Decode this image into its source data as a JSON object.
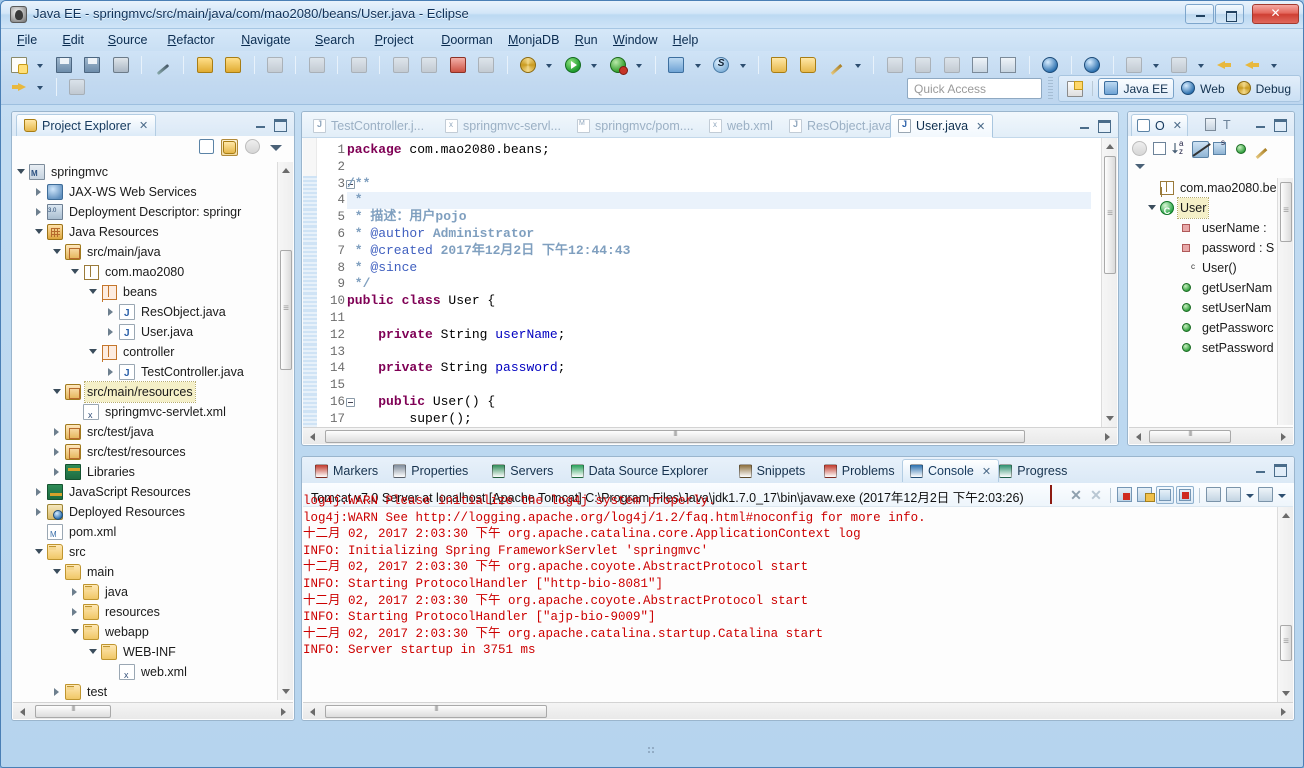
{
  "window": {
    "title": "Java EE - springmvc/src/main/java/com/mao2080/beans/User.java - Eclipse",
    "minimize_label": "",
    "maximize_label": "",
    "close_label": "✕"
  },
  "menubar": [
    {
      "label": "File"
    },
    {
      "label": "Edit"
    },
    {
      "label": "Source"
    },
    {
      "label": "Refactor"
    },
    {
      "label": "Navigate"
    },
    {
      "label": "Search"
    },
    {
      "label": "Project"
    },
    {
      "label": "Doorman"
    },
    {
      "label": "MonjaDB"
    },
    {
      "label": "Run"
    },
    {
      "label": "Window"
    },
    {
      "label": "Help"
    }
  ],
  "toolbar": {
    "quick_access_placeholder": "Quick Access",
    "perspectives": [
      {
        "label": "Java EE",
        "active": true
      },
      {
        "label": "Web",
        "active": false
      },
      {
        "label": "Debug",
        "active": false
      }
    ]
  },
  "project_explorer": {
    "title": "Project Explorer",
    "close": "✕",
    "tree": [
      {
        "label": "springmvc",
        "indent": 0,
        "twist": "open",
        "icon": "ic-proj"
      },
      {
        "label": "JAX-WS Web Services",
        "indent": 1,
        "twist": "closed",
        "icon": "ic-ws"
      },
      {
        "label": "Deployment Descriptor: springr",
        "indent": 1,
        "twist": "closed",
        "icon": "ic-dd"
      },
      {
        "label": "Java Resources",
        "indent": 1,
        "twist": "open",
        "icon": "ic-jres"
      },
      {
        "label": "src/main/java",
        "indent": 2,
        "twist": "open",
        "icon": "ic-pkgf"
      },
      {
        "label": "com.mao2080",
        "indent": 3,
        "twist": "open",
        "icon": "ic-pkg"
      },
      {
        "label": "beans",
        "indent": 4,
        "twist": "open",
        "icon": "ic-pkgo"
      },
      {
        "label": "ResObject.java",
        "indent": 5,
        "twist": "closed",
        "icon": "ic-java"
      },
      {
        "label": "User.java",
        "indent": 5,
        "twist": "closed",
        "icon": "ic-java"
      },
      {
        "label": "controller",
        "indent": 4,
        "twist": "open",
        "icon": "ic-pkgo"
      },
      {
        "label": "TestController.java",
        "indent": 5,
        "twist": "closed",
        "icon": "ic-java"
      },
      {
        "label": "src/main/resources",
        "indent": 2,
        "twist": "open",
        "icon": "ic-pkgf",
        "selected": true
      },
      {
        "label": "springmvc-servlet.xml",
        "indent": 3,
        "twist": "none",
        "icon": "ic-xml"
      },
      {
        "label": "src/test/java",
        "indent": 2,
        "twist": "closed",
        "icon": "ic-pkgf"
      },
      {
        "label": "src/test/resources",
        "indent": 2,
        "twist": "closed",
        "icon": "ic-pkgf"
      },
      {
        "label": "Libraries",
        "indent": 2,
        "twist": "closed",
        "icon": "ic-lib"
      },
      {
        "label": "JavaScript Resources",
        "indent": 1,
        "twist": "closed",
        "icon": "ic-jsres"
      },
      {
        "label": "Deployed Resources",
        "indent": 1,
        "twist": "closed",
        "icon": "ic-depl"
      },
      {
        "label": "pom.xml",
        "indent": 1,
        "twist": "none",
        "icon": "ic-m"
      },
      {
        "label": "src",
        "indent": 1,
        "twist": "open",
        "icon": "ic-folder"
      },
      {
        "label": "main",
        "indent": 2,
        "twist": "open",
        "icon": "ic-folder"
      },
      {
        "label": "java",
        "indent": 3,
        "twist": "closed",
        "icon": "ic-folder"
      },
      {
        "label": "resources",
        "indent": 3,
        "twist": "closed",
        "icon": "ic-folder"
      },
      {
        "label": "webapp",
        "indent": 3,
        "twist": "open",
        "icon": "ic-folder"
      },
      {
        "label": "WEB-INF",
        "indent": 4,
        "twist": "open",
        "icon": "ic-folder"
      },
      {
        "label": "web.xml",
        "indent": 5,
        "twist": "none",
        "icon": "ic-xml"
      },
      {
        "label": "test",
        "indent": 2,
        "twist": "closed",
        "icon": "ic-folder"
      }
    ]
  },
  "editor": {
    "tabs": [
      {
        "label": "TestController.j...",
        "icon": "ei-java",
        "active": false
      },
      {
        "label": "springmvc-servl...",
        "icon": "ei-xml",
        "active": false
      },
      {
        "label": "springmvc/pom....",
        "icon": "ei-m",
        "active": false
      },
      {
        "label": "web.xml",
        "icon": "ei-xml",
        "active": false
      },
      {
        "label": "ResObject.java",
        "icon": "ei-java",
        "active": false
      },
      {
        "label": "User.java",
        "icon": "ei-java",
        "active": true,
        "close": "✕"
      }
    ],
    "code": [
      {
        "n": "1",
        "fold": false,
        "hl": false,
        "anno": false,
        "parts": [
          {
            "t": "package ",
            "c": "kw"
          },
          {
            "t": "com.mao2080.beans;",
            "c": ""
          }
        ]
      },
      {
        "n": "2",
        "fold": false,
        "hl": false,
        "anno": false,
        "parts": []
      },
      {
        "n": "3",
        "fold": true,
        "hl": false,
        "anno": true,
        "parts": [
          {
            "t": "/**",
            "c": "cmt"
          }
        ]
      },
      {
        "n": "4",
        "fold": false,
        "hl": true,
        "anno": true,
        "parts": [
          {
            "t": " * ",
            "c": "cmt"
          }
        ]
      },
      {
        "n": "5",
        "fold": false,
        "hl": false,
        "anno": true,
        "parts": [
          {
            "t": " * 描述：用户pojo",
            "c": "cmt"
          }
        ]
      },
      {
        "n": "6",
        "fold": false,
        "hl": false,
        "anno": true,
        "parts": [
          {
            "t": " * ",
            "c": "cmt"
          },
          {
            "t": "@author",
            "c": "cmj"
          },
          {
            "t": " Administrator",
            "c": "cmt"
          }
        ]
      },
      {
        "n": "7",
        "fold": false,
        "hl": false,
        "anno": true,
        "parts": [
          {
            "t": " * ",
            "c": "cmt"
          },
          {
            "t": "@created",
            "c": "cmj"
          },
          {
            "t": " 2017年12月2日 下午12:44:43",
            "c": "cmt"
          }
        ]
      },
      {
        "n": "8",
        "fold": false,
        "hl": false,
        "anno": true,
        "parts": [
          {
            "t": " * ",
            "c": "cmt"
          },
          {
            "t": "@since",
            "c": "cmj"
          }
        ]
      },
      {
        "n": "9",
        "fold": false,
        "hl": false,
        "anno": true,
        "parts": [
          {
            "t": " */",
            "c": "cmt"
          }
        ]
      },
      {
        "n": "10",
        "fold": false,
        "hl": false,
        "anno": true,
        "parts": [
          {
            "t": "public class ",
            "c": "kw"
          },
          {
            "t": "User {",
            "c": ""
          }
        ]
      },
      {
        "n": "11",
        "fold": false,
        "hl": false,
        "anno": true,
        "parts": []
      },
      {
        "n": "12",
        "fold": false,
        "hl": false,
        "anno": true,
        "parts": [
          {
            "t": "    ",
            "c": ""
          },
          {
            "t": "private ",
            "c": "kw"
          },
          {
            "t": "String ",
            "c": ""
          },
          {
            "t": "userName",
            "c": "fld"
          },
          {
            "t": ";",
            "c": ""
          }
        ]
      },
      {
        "n": "13",
        "fold": false,
        "hl": false,
        "anno": true,
        "parts": []
      },
      {
        "n": "14",
        "fold": false,
        "hl": false,
        "anno": true,
        "parts": [
          {
            "t": "    ",
            "c": ""
          },
          {
            "t": "private ",
            "c": "kw"
          },
          {
            "t": "String ",
            "c": ""
          },
          {
            "t": "password",
            "c": "fld"
          },
          {
            "t": ";",
            "c": ""
          }
        ]
      },
      {
        "n": "15",
        "fold": false,
        "hl": false,
        "anno": true,
        "parts": []
      },
      {
        "n": "16",
        "fold": true,
        "hl": false,
        "anno": true,
        "parts": [
          {
            "t": "    ",
            "c": ""
          },
          {
            "t": "public ",
            "c": "kw"
          },
          {
            "t": "User() {",
            "c": ""
          }
        ]
      },
      {
        "n": "17",
        "fold": false,
        "hl": false,
        "anno": true,
        "parts": [
          {
            "t": "        super();",
            "c": ""
          }
        ]
      }
    ]
  },
  "outline": {
    "title": "O",
    "close": "✕",
    "alt_tab": "T",
    "items": [
      {
        "label": "com.mao2080.be",
        "indent": 0,
        "icon": "oi-pkg",
        "twist": "none"
      },
      {
        "label": "User",
        "indent": 0,
        "icon": "oi-class",
        "twist": "open",
        "selected": true
      },
      {
        "label": "userName :",
        "indent": 1,
        "icon": "oi-field",
        "twist": "none"
      },
      {
        "label": "password : S",
        "indent": 1,
        "icon": "oi-field",
        "twist": "none"
      },
      {
        "label": "User()",
        "indent": 1,
        "icon": "oi-ctor",
        "twist": "none"
      },
      {
        "label": "getUserNam",
        "indent": 1,
        "icon": "oi-meth",
        "twist": "none"
      },
      {
        "label": "setUserNam",
        "indent": 1,
        "icon": "oi-meth",
        "twist": "none"
      },
      {
        "label": "getPassworc",
        "indent": 1,
        "icon": "oi-meth",
        "twist": "none"
      },
      {
        "label": "setPassword",
        "indent": 1,
        "icon": "oi-meth",
        "twist": "none"
      }
    ]
  },
  "bottom_panel": {
    "tabs": [
      {
        "label": "Markers",
        "icon": "markers-icon",
        "active": false
      },
      {
        "label": "Properties",
        "icon": "properties-icon",
        "active": false
      },
      {
        "label": "Servers",
        "icon": "servers-icon",
        "active": false
      },
      {
        "label": "Data Source Explorer",
        "icon": "datasource-icon",
        "active": false
      },
      {
        "label": "Snippets",
        "icon": "snippets-icon",
        "active": false
      },
      {
        "label": "Problems",
        "icon": "problems-icon",
        "active": false
      },
      {
        "label": "Console",
        "icon": "console-icon",
        "active": true,
        "close": "✕"
      },
      {
        "label": "Progress",
        "icon": "progress-icon",
        "active": false
      }
    ],
    "console_title": "Tomcat v7.0 Server at localhost [Apache Tomcat] C:\\Program Files\\Java\\jdk1.7.0_17\\bin\\javaw.exe (2017年12月2日 下午2:03:26)",
    "console_lines": [
      "log4j:WARN Please initialize the log4j system properly.",
      "log4j:WARN See http://logging.apache.org/log4j/1.2/faq.html#noconfig for more info.",
      "十二月 02, 2017 2:03:30 下午 org.apache.catalina.core.ApplicationContext log",
      "INFO: Initializing Spring FrameworkServlet 'springmvc'",
      "十二月 02, 2017 2:03:30 下午 org.apache.coyote.AbstractProtocol start",
      "INFO: Starting ProtocolHandler [\"http-bio-8081\"]",
      "十二月 02, 2017 2:03:30 下午 org.apache.coyote.AbstractProtocol start",
      "INFO: Starting ProtocolHandler [\"ajp-bio-9009\"]",
      "十二月 02, 2017 2:03:30 下午 org.apache.catalina.startup.Catalina start",
      "INFO: Server startup in 3751 ms"
    ]
  },
  "colors": {
    "title_bar": "#cfe4f7",
    "accent": "#2a5fa8",
    "console_text": "#cc0000",
    "keyword": "#7f0055",
    "comment": "#3f7f5f",
    "javadoc_tag": "#3f5fbf",
    "field": "#0000c0",
    "selection": "#f5f0c8"
  }
}
